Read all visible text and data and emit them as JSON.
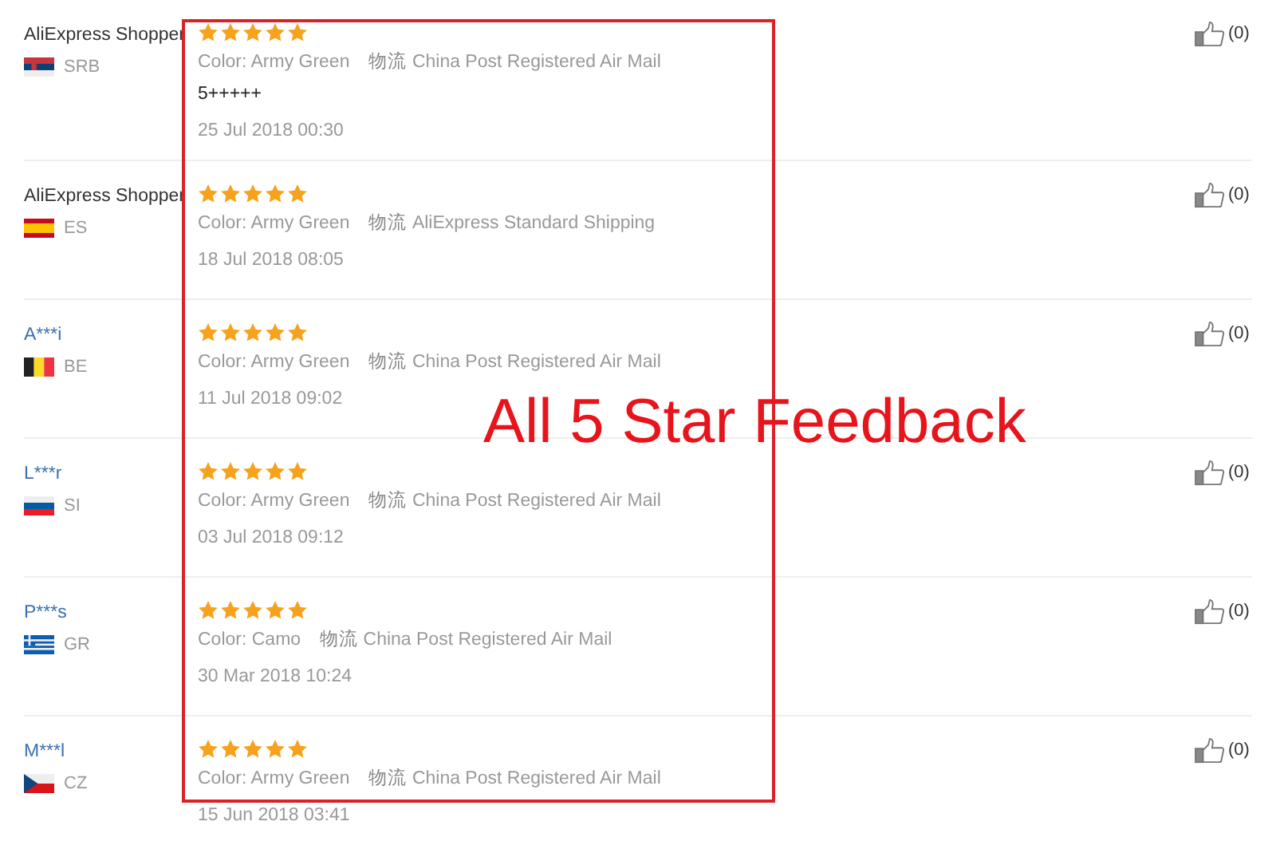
{
  "reviews": [
    {
      "name": "AliExpress Shopper",
      "masked": false,
      "country": "SRB",
      "stars": 5,
      "color_option": "Color: Army Green",
      "shipping_label": "物流",
      "shipping": "China Post Registered Air Mail",
      "comment": "5+++++",
      "date": "25 Jul 2018 00:30",
      "helpful": "(0)"
    },
    {
      "name": "AliExpress Shopper",
      "masked": false,
      "country": "ES",
      "stars": 5,
      "color_option": "Color: Army Green",
      "shipping_label": "物流",
      "shipping": "AliExpress Standard Shipping",
      "date": "18 Jul 2018 08:05",
      "helpful": "(0)"
    },
    {
      "name": "A***i",
      "masked": true,
      "country": "BE",
      "stars": 5,
      "color_option": "Color: Army Green",
      "shipping_label": "物流",
      "shipping": "China Post Registered Air Mail",
      "date": "11 Jul 2018 09:02",
      "helpful": "(0)"
    },
    {
      "name": "L***r",
      "masked": true,
      "country": "SI",
      "stars": 5,
      "color_option": "Color: Army Green",
      "shipping_label": "物流",
      "shipping": "China Post Registered Air Mail",
      "date": "03 Jul 2018 09:12",
      "helpful": "(0)"
    },
    {
      "name": "P***s",
      "masked": true,
      "country": "GR",
      "stars": 5,
      "color_option": "Color: Camo",
      "shipping_label": "物流",
      "shipping": "China Post Registered Air Mail",
      "date": "30 Mar 2018 10:24",
      "helpful": "(0)"
    },
    {
      "name": "M***l",
      "masked": true,
      "country": "CZ",
      "stars": 5,
      "color_option": "Color: Army Green",
      "shipping_label": "物流",
      "shipping": "China Post Registered Air Mail",
      "date": "15 Jun 2018 03:41",
      "helpful": "(0)"
    }
  ],
  "annotation": {
    "text": "All 5 Star Feedback"
  }
}
